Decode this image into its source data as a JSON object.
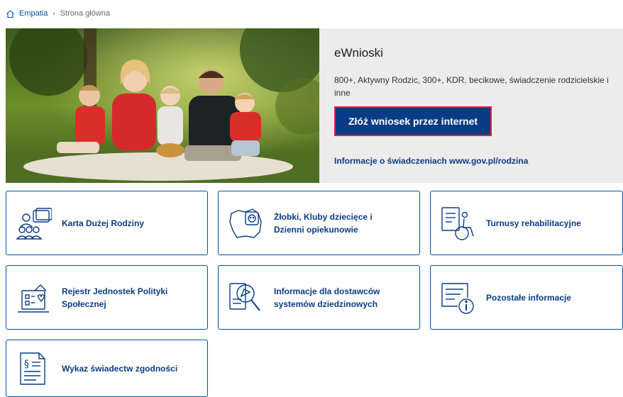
{
  "breadcrumb": {
    "home_label": "Empatia",
    "current": "Strona główna",
    "separator": "›"
  },
  "hero": {
    "title": "eWnioski",
    "description": "800+, Aktywny Rodzic, 300+, KDR, becikowe, świadczenie rodzicielskie i inne",
    "cta_label": "Złóż wniosek przez internet",
    "info_link": "Informacje o świadczeniach www.gov.pl/rodzina"
  },
  "tiles": [
    {
      "label": "Karta Dużej Rodziny",
      "icon": "family-card-icon"
    },
    {
      "label": "Żłobki, Kluby dziecięce i Dzienni opiekunowie",
      "icon": "poland-map-child-icon"
    },
    {
      "label": "Turnusy rehabilitacyjne",
      "icon": "wheelchair-document-icon"
    },
    {
      "label": "Rejestr Jednostek Polityki Społecznej",
      "icon": "building-heart-icon"
    },
    {
      "label": "Informacje dla dostawców systemów dziedzinowych",
      "icon": "document-magnifier-icon"
    },
    {
      "label": "Pozostałe informacje",
      "icon": "info-document-icon"
    },
    {
      "label": "Wykaz świadectw zgodności",
      "icon": "paragraph-document-icon"
    }
  ],
  "colors": {
    "primary": "#0a3c85",
    "link": "#0052a5",
    "cta_border": "#d9243a",
    "hero_bg": "#ececec"
  }
}
